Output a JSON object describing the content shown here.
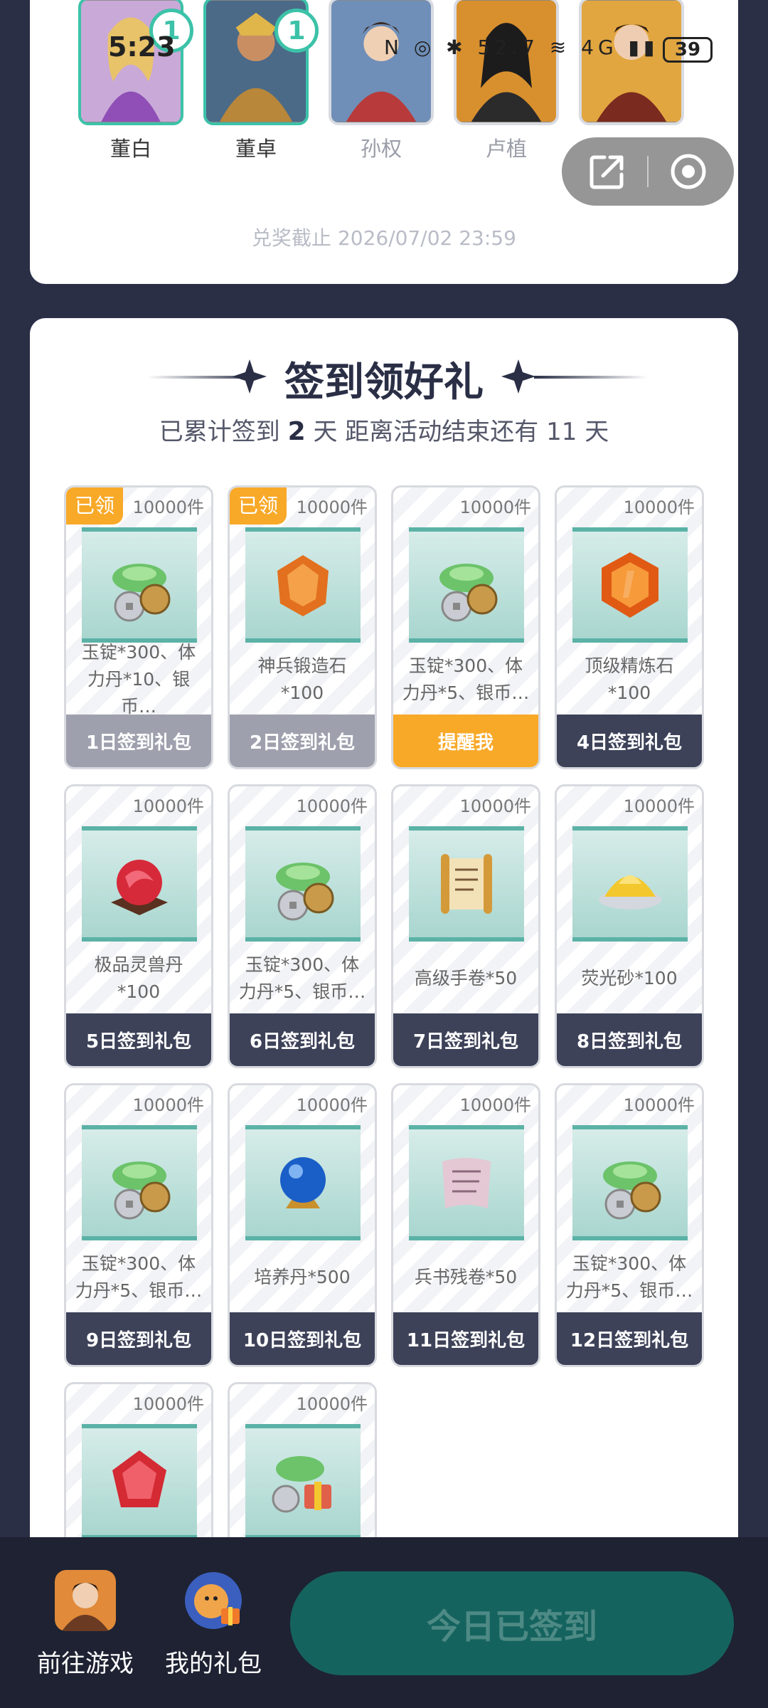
{
  "status_bar": {
    "time": "5:23",
    "icons": "N ◎ ✱ 52.7 ≋ 4G ▮▮",
    "battery": "39"
  },
  "heroes": [
    {
      "name": "董白",
      "badge": "1",
      "selected": true
    },
    {
      "name": "董卓",
      "badge": "1",
      "selected": true
    },
    {
      "name": "孙权",
      "badge": "",
      "selected": false
    },
    {
      "name": "卢植",
      "badge": "",
      "selected": false
    },
    {
      "name": "",
      "badge": "",
      "selected": false
    }
  ],
  "deadline": "兑奖截止 2026/07/02 23:59",
  "signin": {
    "title": "签到领好礼",
    "summary_prefix": "已累计签到",
    "days_signed": "2",
    "summary_mid": "天  距离活动结束还有",
    "days_left": "11",
    "summary_suffix": "天"
  },
  "gifts": [
    {
      "stock": "10000件",
      "claimed_tag": "已领",
      "desc": "玉锭*300、体力丹*10、银币…",
      "button": "1日签到礼包",
      "state": "claimed",
      "icon": "ingot-coin-icon"
    },
    {
      "stock": "10000件",
      "claimed_tag": "已领",
      "desc": "神兵锻造石*100",
      "button": "2日签到礼包",
      "state": "claimed",
      "icon": "forge-stone-icon"
    },
    {
      "stock": "10000件",
      "claimed_tag": "",
      "desc": "玉锭*300、体力丹*5、银币…",
      "button": "提醒我",
      "state": "remind",
      "icon": "ingot-coin-icon"
    },
    {
      "stock": "10000件",
      "claimed_tag": "",
      "desc": "顶级精炼石*100",
      "button": "4日签到礼包",
      "state": "locked",
      "icon": "refine-stone-icon"
    },
    {
      "stock": "10000件",
      "claimed_tag": "",
      "desc": "极品灵兽丹*100",
      "button": "5日签到礼包",
      "state": "locked",
      "icon": "beast-pill-icon"
    },
    {
      "stock": "10000件",
      "claimed_tag": "",
      "desc": "玉锭*300、体力丹*5、银币…",
      "button": "6日签到礼包",
      "state": "locked",
      "icon": "ingot-coin-icon"
    },
    {
      "stock": "10000件",
      "claimed_tag": "",
      "desc": "高级手卷*50",
      "button": "7日签到礼包",
      "state": "locked",
      "icon": "scroll-icon"
    },
    {
      "stock": "10000件",
      "claimed_tag": "",
      "desc": "荧光砂*100",
      "button": "8日签到礼包",
      "state": "locked",
      "icon": "glow-sand-icon"
    },
    {
      "stock": "10000件",
      "claimed_tag": "",
      "desc": "玉锭*300、体力丹*5、银币…",
      "button": "9日签到礼包",
      "state": "locked",
      "icon": "ingot-coin-icon"
    },
    {
      "stock": "10000件",
      "claimed_tag": "",
      "desc": "培养丹*500",
      "button": "10日签到礼包",
      "state": "locked",
      "icon": "crystal-orb-icon"
    },
    {
      "stock": "10000件",
      "claimed_tag": "",
      "desc": "兵书残卷*50",
      "button": "11日签到礼包",
      "state": "locked",
      "icon": "book-fragment-icon"
    },
    {
      "stock": "10000件",
      "claimed_tag": "",
      "desc": "玉锭*300、体力丹*5、银币…",
      "button": "12日签到礼包",
      "state": "locked",
      "icon": "ingot-coin-icon"
    },
    {
      "stock": "10000件",
      "claimed_tag": "",
      "desc": "",
      "button": "",
      "state": "locked",
      "icon": "red-gem-icon"
    },
    {
      "stock": "10000件",
      "claimed_tag": "",
      "desc": "",
      "button": "",
      "state": "locked",
      "icon": "ingot-chest-icon"
    }
  ],
  "bottom": {
    "go_game": "前往游戏",
    "my_gifts": "我的礼包",
    "checkin": "今日已签到"
  },
  "colors": {
    "accent_teal": "#3cc2a8",
    "remind_orange": "#f8a928",
    "dark_navy": "#2a2f46",
    "checkin_green": "#15635e"
  }
}
